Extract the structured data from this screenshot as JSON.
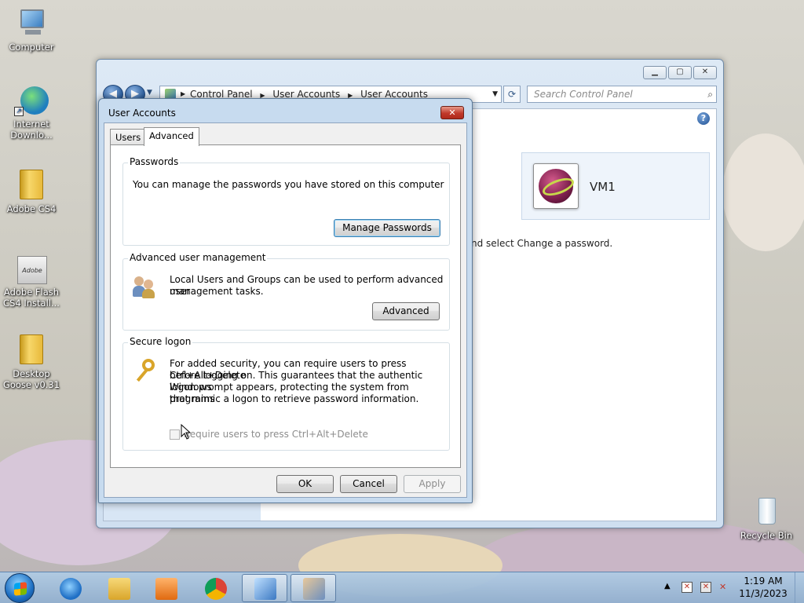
{
  "desktop": {
    "icons": [
      {
        "label": "Computer"
      },
      {
        "label": "Internet Downlo..."
      },
      {
        "label": "Adobe CS4"
      },
      {
        "label": "Adobe Flash CS4 Install..."
      },
      {
        "label": "Desktop Goose v0.31"
      },
      {
        "label": "Recycle Bin"
      }
    ],
    "adobe_badge": "Adobe"
  },
  "explorer": {
    "breadcrumb": [
      "Control Panel",
      "User Accounts",
      "User Accounts"
    ],
    "search_placeholder": "Search Control Panel",
    "user_name": "VM1",
    "hint_text": "nd select Change a password."
  },
  "dialog": {
    "title": "User Accounts",
    "tabs": [
      {
        "label": "Users",
        "active": false
      },
      {
        "label": "Advanced",
        "active": true
      }
    ],
    "passwords": {
      "title": "Passwords",
      "text": "You can manage the passwords you have stored on this computer",
      "button": "Manage Passwords"
    },
    "advanced_user_management": {
      "title": "Advanced user management",
      "text_line1": "Local Users and Groups can be used to perform advanced user",
      "text_line2": "management tasks.",
      "button": "Advanced"
    },
    "secure_logon": {
      "title": "Secure logon",
      "text_lines": [
        "For added security, you can require users to press Ctrl+Alt+Delete",
        "before logging on. This guarantees that the authentic Windows",
        "logon prompt appears, protecting the system from programs",
        "that mimic a logon to retrieve password information."
      ],
      "checkbox_label": "Require users to press Ctrl+Alt+Delete",
      "checkbox_checked": false,
      "checkbox_enabled": false
    },
    "buttons": {
      "ok": "OK",
      "cancel": "Cancel",
      "apply": "Apply"
    }
  },
  "taskbar": {
    "clock_time": "1:19 AM",
    "clock_date": "11/3/2023",
    "pinned": [
      "internet-explorer",
      "windows-explorer",
      "media-player",
      "chrome",
      "control-panel",
      "user-accounts"
    ]
  },
  "colors": {
    "accent": "#3c7fb1",
    "dialog_frame": "#c7dbef",
    "close_button": "#c0392b"
  }
}
